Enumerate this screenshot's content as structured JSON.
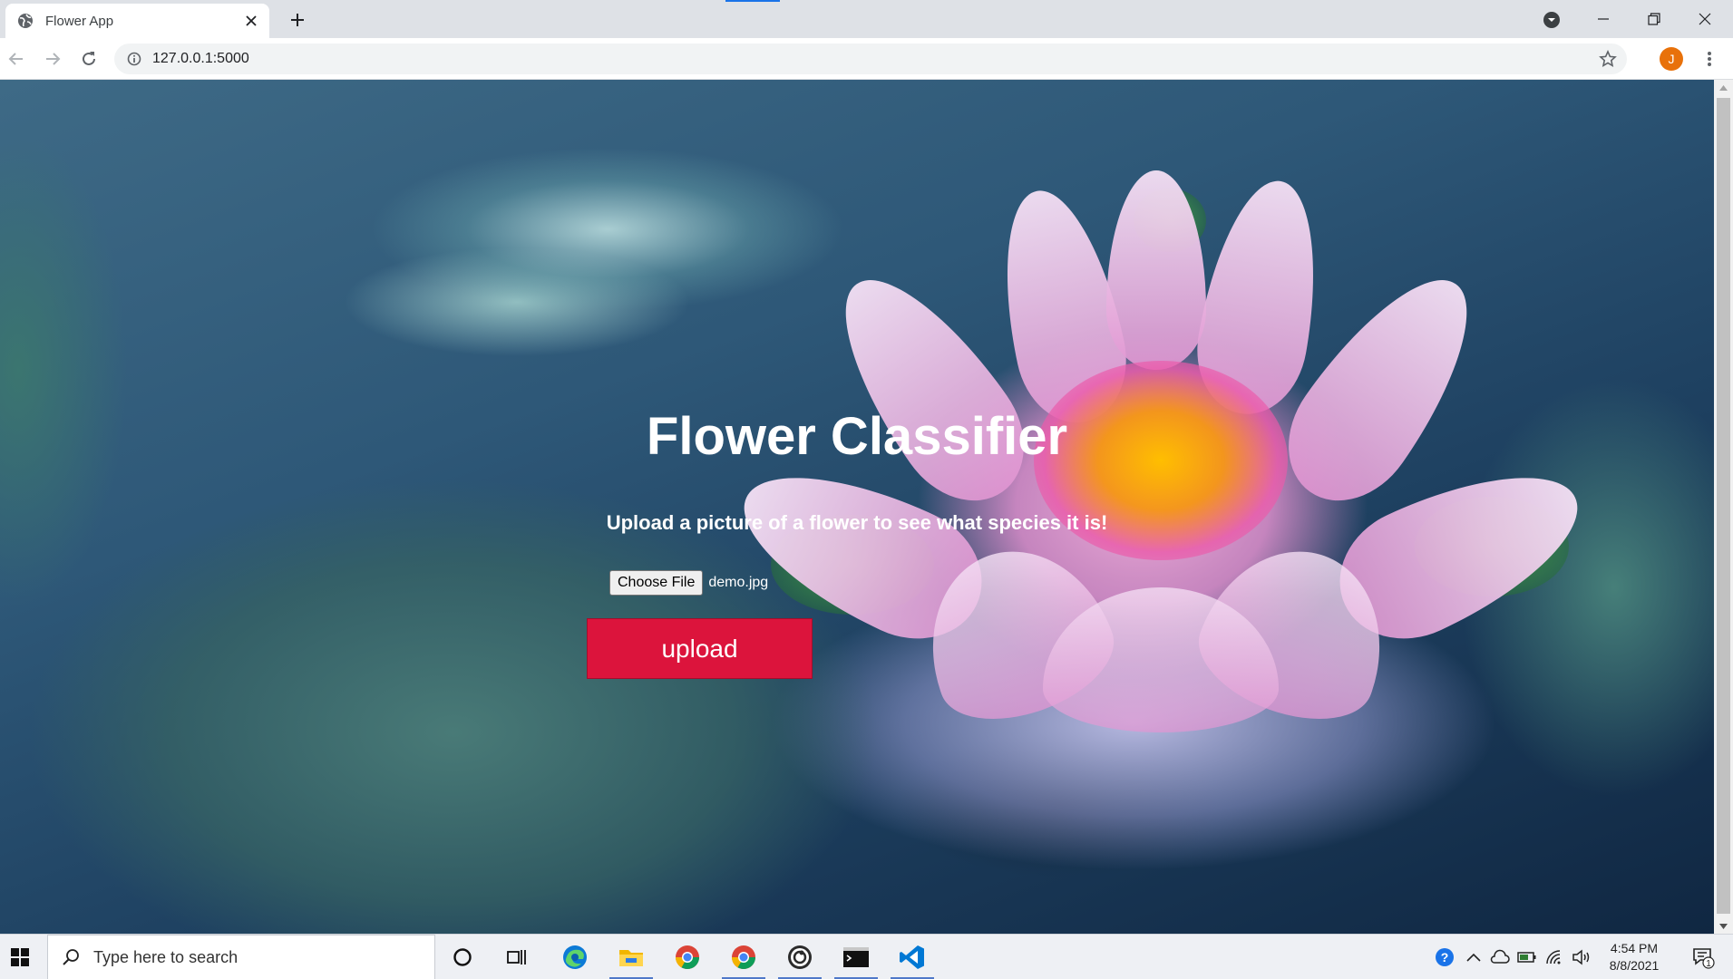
{
  "browser": {
    "tab_title": "Flower App",
    "url": "127.0.0.1:5000",
    "profile_initial": "J"
  },
  "page": {
    "title": "Flower Classifier",
    "subtitle": "Upload a picture of a flower to see what species it is!",
    "choose_file_label": "Choose File",
    "file_name": "demo.jpg",
    "upload_label": "upload",
    "upload_color": "#dc143c"
  },
  "taskbar": {
    "search_placeholder": "Type here to search",
    "time": "4:54 PM",
    "date": "8/8/2021",
    "notification_count": "1",
    "apps": [
      "cortana-icon",
      "task-view-icon",
      "edge-icon",
      "file-explorer-icon",
      "chrome-icon",
      "chrome-icon",
      "obs-icon",
      "terminal-icon",
      "vscode-icon"
    ]
  }
}
